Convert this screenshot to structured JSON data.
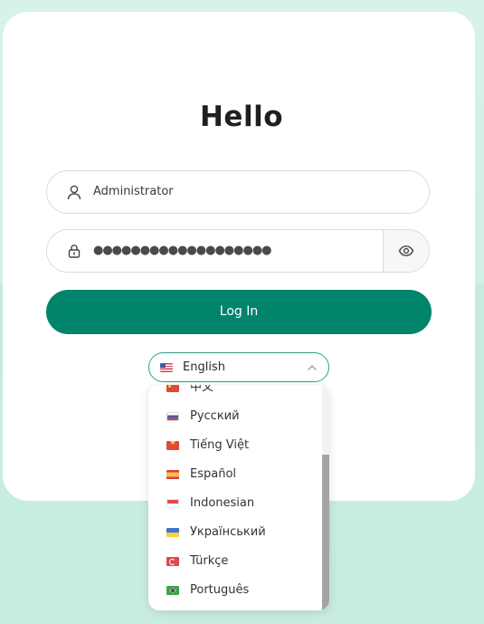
{
  "login": {
    "title": "Hello",
    "username_value": "Administrator",
    "password_value": "●●●●●●●●●●●●●●●●●●●",
    "login_label": "Log In"
  },
  "language": {
    "selected_label": "English",
    "selected_flag": "flag-us",
    "options": [
      {
        "label": "中文",
        "flag": "flag-cn"
      },
      {
        "label": "Русский",
        "flag": "flag-ru"
      },
      {
        "label": "Tiếng Việt",
        "flag": "flag-vn"
      },
      {
        "label": "Español",
        "flag": "flag-es"
      },
      {
        "label": "Indonesian",
        "flag": "flag-id"
      },
      {
        "label": "Український",
        "flag": "flag-ua"
      },
      {
        "label": "Türkçe",
        "flag": "flag-tr"
      },
      {
        "label": "Português",
        "flag": "flag-br"
      }
    ]
  },
  "colors": {
    "accent": "#00846c",
    "select_border": "#2ca284",
    "background": "#d2f0e7"
  },
  "icons": {
    "username": "user-icon",
    "password": "lock-icon",
    "toggle_visibility": "eye-icon",
    "dropdown": "chevron-up-icon"
  }
}
